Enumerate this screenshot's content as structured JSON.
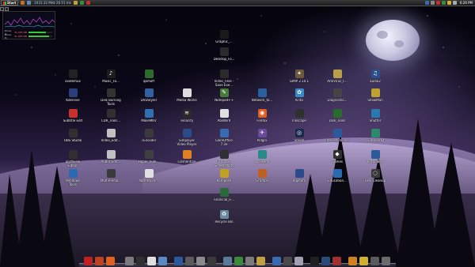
{
  "topbar": {
    "start_label": "Start",
    "cpu_readout": "2431.32 MHz   26.51 ms",
    "clock": "6:26 PM"
  },
  "gadget": {
    "rows": [
      {
        "label": "Drive C:",
        "value": "31,485 MB",
        "fill_pct": 72
      },
      {
        "label": "Drive D:",
        "value": "31,485 MB",
        "fill_pct": 85
      }
    ]
  },
  "desktop_icons": [
    {
      "name": "Graphic_...",
      "icon": "graphic-icon",
      "color": "#1a1a1a"
    },
    {
      "name": "Desktop_Fo...",
      "icon": "desktop-folder-icon",
      "color": "#2a2a2a"
    },
    {
      "name": "avidemux",
      "icon": "avidemux-icon",
      "color": "#222222"
    },
    {
      "name": "Music_Fa...",
      "icon": "music-icon",
      "color": "#1d1d1d"
    },
    {
      "name": "qomoff",
      "icon": "qomoff-icon",
      "color": "#2d6a2d"
    },
    {
      "name": "Video_Files -\nSave Exe...",
      "icon": "video-files-icon",
      "color": "#2a2a2a"
    },
    {
      "name": "GIMP 2.10.1",
      "icon": "gimp-icon",
      "color": "#6b5a3b"
    },
    {
      "name": "AntiVirus_F...",
      "icon": "antivirus-icon",
      "color": "#b8a048"
    },
    {
      "name": "audio2",
      "icon": "audio-icon",
      "color": "#2a4f8a"
    },
    {
      "name": "Kdenlive",
      "icon": "kdenlive-icon",
      "color": "#2a3f7a"
    },
    {
      "name": "Disk Burning\nTools",
      "icon": "disk-burning-icon",
      "color": "#333333"
    },
    {
      "name": "DVDStyler",
      "icon": "dvdstyler-icon",
      "color": "#3060a0"
    },
    {
      "name": "Media Works",
      "icon": "media-works-icon",
      "color": "#dddddd"
    },
    {
      "name": "Notepad++",
      "icon": "notepad-plus-icon",
      "color": "#4a7a3a"
    },
    {
      "name": "Network_to...",
      "icon": "network-icon",
      "color": "#2a60a0"
    },
    {
      "name": "Krita",
      "icon": "krita-icon",
      "color": "#3a8ac8"
    },
    {
      "name": "Diagnostic...",
      "icon": "diagnostic-icon",
      "color": "#444444"
    },
    {
      "name": "ShowMan",
      "icon": "showman-icon",
      "color": "#c0a030"
    },
    {
      "name": "Subtitle Edit",
      "icon": "subtitle-edit-icon",
      "color": "#c83030"
    },
    {
      "name": "CDR_Tools...",
      "icon": "cdr-tools-icon",
      "color": "#303030"
    },
    {
      "name": "MakeMKV",
      "icon": "makemkv-icon",
      "color": "#3070b0"
    },
    {
      "name": "Tenacity",
      "icon": "tenacity-icon",
      "color": "#2a2a2a"
    },
    {
      "name": "AbiWord",
      "icon": "abiword-icon",
      "color": "#e0e0e0"
    },
    {
      "name": "Firefox",
      "icon": "firefox-icon",
      "color": "#e06020"
    },
    {
      "name": "Inkscape",
      "icon": "inkscape-icon",
      "color": "#303030"
    },
    {
      "name": "Disk_Tools",
      "icon": "disk-tools-icon",
      "color": "#2a6a2a"
    },
    {
      "name": "Shutter",
      "icon": "shutter-icon",
      "color": "#2a7ab0"
    },
    {
      "name": "OBS Studio",
      "icon": "obs-studio-icon",
      "color": "#303030"
    },
    {
      "name": "Video_Edit...",
      "icon": "video-edit-icon",
      "color": "#c0c0c0"
    },
    {
      "name": "TEncoder",
      "icon": "tencoder-icon",
      "color": "#3a3a3a"
    },
    {
      "name": "Simplayer\nVideo Player",
      "icon": "video-player-icon",
      "color": "#2a4a8a"
    },
    {
      "name": "LibreOffice\n7.3e",
      "icon": "libreoffice-icon",
      "color": "#3a6ab0"
    },
    {
      "name": "Pidgin",
      "icon": "pidgin-icon",
      "color": "#6a4a9a"
    },
    {
      "name": "Steam",
      "icon": "steam-icon",
      "color": "#1a2a4a"
    },
    {
      "name": "Internet_Tools...",
      "icon": "internet-tools-icon",
      "color": "#2a5a9a"
    },
    {
      "name": "CCleaner64",
      "icon": "ccleaner-icon",
      "color": "#2a8a6a"
    },
    {
      "name": "qpdfview\nEditor",
      "icon": "qpdfview-icon",
      "color": "#303030"
    },
    {
      "name": "Audio_Edit...",
      "icon": "audio-edit-icon",
      "color": "#c0c0c0"
    },
    {
      "name": "Hyper_Vide...",
      "icon": "hyper-video-icon",
      "color": "#404040"
    },
    {
      "name": "Clementine",
      "icon": "clementine-icon",
      "color": "#e08020"
    },
    {
      "name": "Thumbs\nScreenshots",
      "icon": "thumbs-icon",
      "color": "#303030"
    },
    {
      "name": "localsend",
      "icon": "localsend-icon",
      "color": "#2a8a8a"
    },
    {
      "name": "Games",
      "icon": "games-icon",
      "color": "#303030"
    },
    {
      "name": "VirtualBox",
      "icon": "virtualbox-icon",
      "color": "#2a5a9a"
    },
    {
      "name": "Windows\nTools",
      "icon": "windows-tools-icon",
      "color": "#2a6ab0"
    },
    {
      "name": "Multimedia...",
      "icon": "multimedia-icon",
      "color": "#3a3a3a"
    },
    {
      "name": "NotheyOn...",
      "icon": "nothey-icon",
      "color": "#e0e0e0"
    },
    {
      "name": "Kompose",
      "icon": "kompose-icon",
      "color": "#c0a020"
    },
    {
      "name": "Gramps",
      "icon": "gramps-icon",
      "color": "#c06020"
    },
    {
      "name": "digiKam",
      "icon": "digikam-icon",
      "color": "#2a4a8a"
    },
    {
      "name": "Education...",
      "icon": "education-icon",
      "color": "#2a6ab0"
    },
    {
      "name": "Disk Cleanup",
      "icon": "disk-cleanup-icon",
      "color": "#3a3a3a"
    },
    {
      "name": "Financial_Fi...",
      "icon": "financial-icon",
      "color": "#2a6a3a"
    },
    {
      "name": "Recycle Bin",
      "icon": "recycle-bin-icon",
      "color": "#6a8aa0"
    }
  ],
  "dock_items": [
    {
      "icon": "red-app-icon",
      "color": "#c02020"
    },
    {
      "icon": "ball-icon",
      "color": "#c04020"
    },
    {
      "icon": "firefox-icon",
      "color": "#e06020"
    },
    {
      "icon": "utility-icon",
      "color": "#7a7a7a"
    },
    {
      "icon": "joystick-icon",
      "color": "#303030"
    },
    {
      "icon": "document-icon",
      "color": "#e0e0e0"
    },
    {
      "icon": "image-icon",
      "color": "#5a8ac0"
    },
    {
      "icon": "globe-icon",
      "color": "#2a5a9a"
    },
    {
      "icon": "settings-icon",
      "color": "#5a5a5a"
    },
    {
      "icon": "ball-icon",
      "color": "#8a8a8a"
    },
    {
      "icon": "camera-icon",
      "color": "#3a3a3a"
    },
    {
      "icon": "screen-icon",
      "color": "#5a7a9a"
    },
    {
      "icon": "chat-icon",
      "color": "#3a8a3a"
    },
    {
      "icon": "tool-icon",
      "color": "#7a7a7a"
    },
    {
      "icon": "folder-icon",
      "color": "#c0a040"
    },
    {
      "icon": "folder-icon",
      "color": "#3a6ab0"
    },
    {
      "icon": "printer-icon",
      "color": "#4a4a4a"
    },
    {
      "icon": "disc-icon",
      "color": "#a0a0b0"
    },
    {
      "icon": "terminal-icon",
      "color": "#202020"
    },
    {
      "icon": "media-icon",
      "color": "#2a4a7a"
    },
    {
      "icon": "music-icon",
      "color": "#a03030"
    },
    {
      "icon": "gear-icon",
      "color": "#d08020"
    },
    {
      "icon": "smile-icon",
      "color": "#d0b030"
    },
    {
      "icon": "stack-icon",
      "color": "#5a5a5a"
    },
    {
      "icon": "trash-icon",
      "color": "#6a6a6a"
    }
  ]
}
